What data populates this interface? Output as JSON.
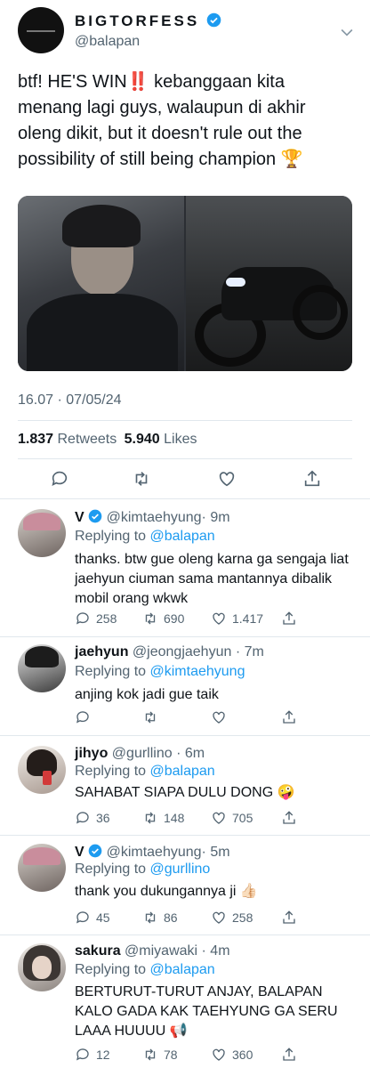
{
  "tweet": {
    "author_name": "BIGTORFESS",
    "author_handle": "@balapan",
    "text_line1": "btf! HE'S WIN‼️ kebanggaan kita",
    "text_line2": "menang lagi guys, walaupun di akhir",
    "text_line3": "oleng dikit, but it doesn't rule out the",
    "text_line4": "possibility of still being champion 🏆",
    "timestamp": "16.07 · 07/05/24",
    "retweet_count": "1.837",
    "retweet_label": "Retweets",
    "like_count": "5.940",
    "like_label": "Likes"
  },
  "replies": [
    {
      "name": "V",
      "handle": "@kimtaehyung",
      "time": "· 9m",
      "replying_label": "Replying to",
      "replying_to": "@balapan",
      "text": "thanks. btw gue oleng karna ga sengaja liat jaehyun ciuman sama mantannya dibalik mobil orang wkwk",
      "replies": "258",
      "retweets": "690",
      "likes": "1.417"
    },
    {
      "name": "jaehyun",
      "handle": "@jeongjaehyun",
      "time": "· 7m",
      "replying_label": "Replying to",
      "replying_to": "@kimtaehyung",
      "text": "anjing kok jadi gue taik"
    },
    {
      "name": "jihyo",
      "handle": "@gurllino",
      "time": "· 6m",
      "replying_label": "Replying to",
      "replying_to": "@balapan",
      "text": "SAHABAT SIAPA DULU DONG 🤪",
      "replies": "36",
      "retweets": "148",
      "likes": "705"
    },
    {
      "name": "V",
      "handle": "@kimtaehyung",
      "time": "· 5m",
      "replying_label": "Replying to",
      "replying_to": "@gurllino",
      "text": "thank you dukungannya ji 👍🏻",
      "replies": "45",
      "retweets": "86",
      "likes": "258"
    },
    {
      "name": "sakura",
      "handle": "@miyawaki",
      "time": "· 4m",
      "replying_label": "Replying to",
      "replying_to": "@balapan",
      "text": "BERTURUT-TURUT ANJAY, BALAPAN KALO GADA KAK TAEHYUNG GA SERU LAAA HUUUU 📢",
      "replies": "12",
      "retweets": "78",
      "likes": "360"
    }
  ],
  "colors": {
    "accent": "#1d9bf0",
    "muted": "#536471",
    "divider": "#e1e8ed"
  }
}
